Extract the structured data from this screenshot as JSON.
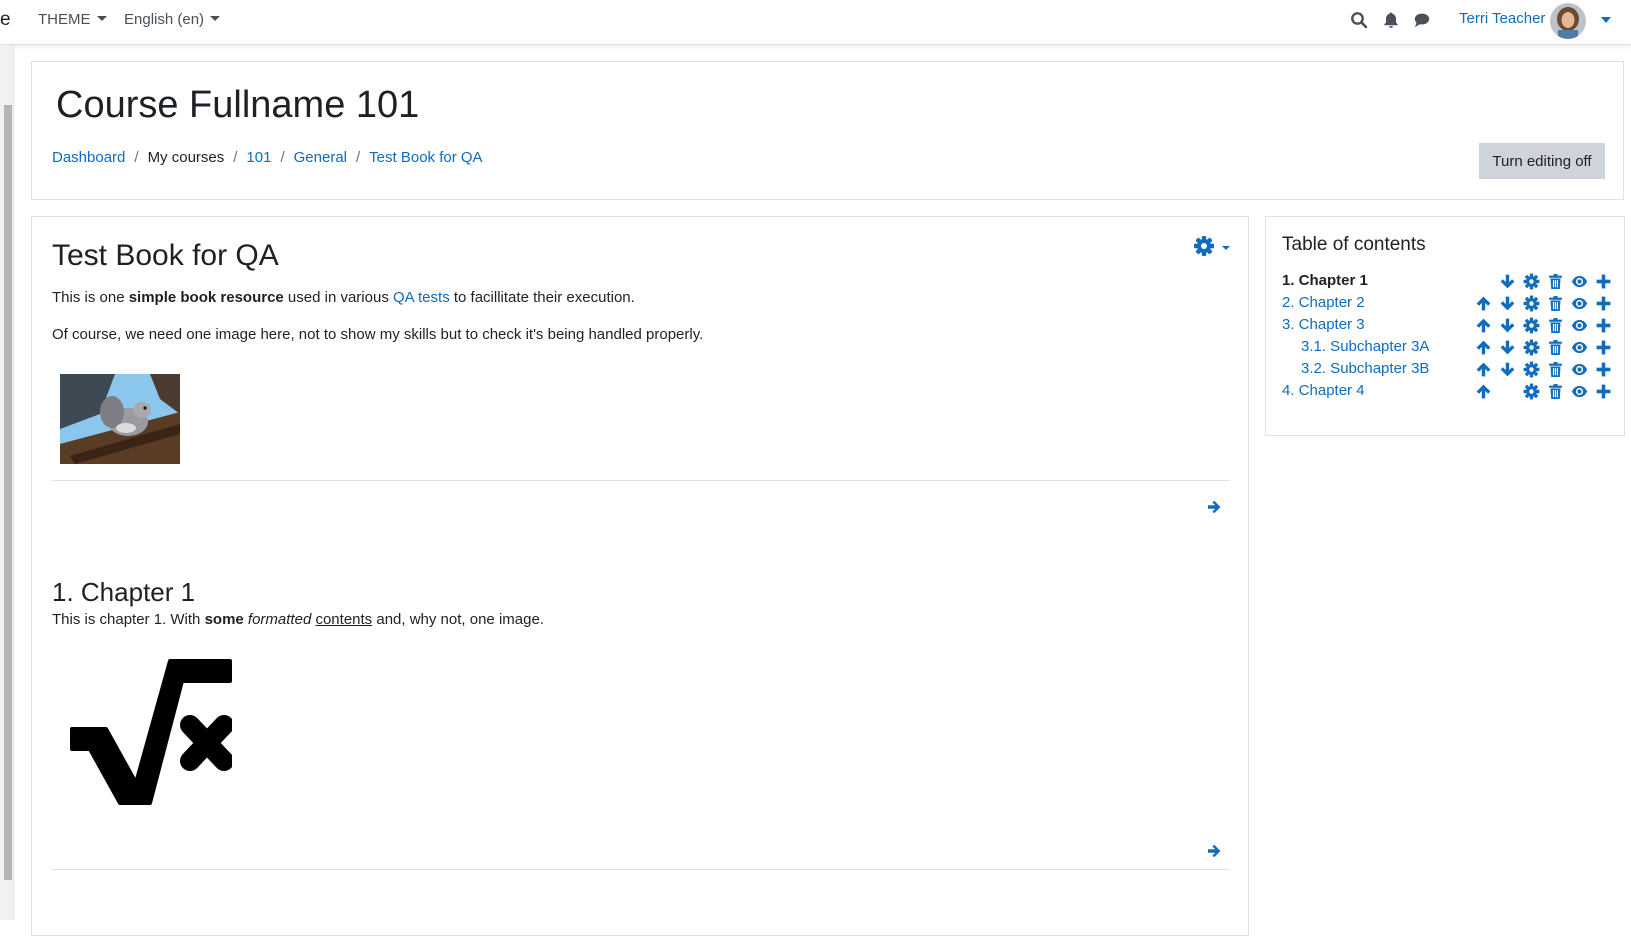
{
  "navbar": {
    "brand_fragment": "e",
    "theme_label": "THEME",
    "language_label": "English (en)",
    "user_name": "Terri Teacher"
  },
  "header": {
    "course_title": "Course Fullname 101",
    "breadcrumb": [
      "Dashboard",
      "My courses",
      "101",
      "General",
      "Test Book for QA"
    ],
    "edit_button": "Turn editing off"
  },
  "main": {
    "book_title": "Test Book for QA",
    "intro": {
      "p1_a": "This is one ",
      "p1_bold": "simple book resource",
      "p1_b": " used in various ",
      "p1_link": "QA tests",
      "p1_c": " to facillitate their execution.",
      "p2": "Of course, we need one image here, not to show my skills but to check it's being handled properly."
    },
    "chapter": {
      "title": "1. Chapter 1",
      "text_a": "This is chapter 1. With ",
      "text_bold": "some",
      "text_italic": "formatted",
      "text_underline": "contents",
      "text_b": " and, why not, one image."
    }
  },
  "toc": {
    "title": "Table of contents",
    "items": [
      {
        "label": "1. Chapter 1",
        "current": true,
        "actions": [
          "down",
          "settings",
          "delete",
          "hide",
          "add"
        ]
      },
      {
        "label": "2. Chapter 2",
        "current": false,
        "actions": [
          "up",
          "down",
          "settings",
          "delete",
          "hide",
          "add"
        ]
      },
      {
        "label": "3. Chapter 3",
        "current": false,
        "actions": [
          "up",
          "down",
          "settings",
          "delete",
          "hide",
          "add"
        ]
      },
      {
        "label": "3.1. Subchapter 3A",
        "current": false,
        "actions": [
          "up",
          "down",
          "settings",
          "delete",
          "hide",
          "add"
        ]
      },
      {
        "label": "3.2. Subchapter 3B",
        "current": false,
        "actions": [
          "up",
          "down",
          "settings",
          "delete",
          "hide",
          "add"
        ]
      },
      {
        "label": "4. Chapter 4",
        "current": false,
        "actions": [
          "up",
          "settings",
          "delete",
          "hide",
          "add"
        ]
      }
    ]
  },
  "colors": {
    "link": "#0f6cbf",
    "text": "#1d2125",
    "button_bg": "#ced4da",
    "border": "#dee2e6"
  }
}
